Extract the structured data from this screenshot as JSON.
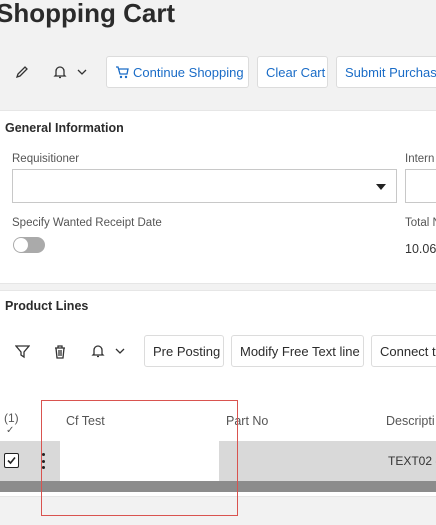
{
  "page": {
    "title": "Shopping Cart"
  },
  "toolbar": {
    "continue_label": "Continue Shopping",
    "clear_label": "Clear Cart",
    "submit_label": "Submit Purchase"
  },
  "general": {
    "title": "General Information",
    "requisitioner_label": "Requisitioner",
    "requisitioner_value": "",
    "internal_label": "Intern",
    "wanted_date_label": "Specify Wanted Receipt Date",
    "total_label": "Total N",
    "total_value": "10.06"
  },
  "lines": {
    "title": "Product Lines",
    "buttons": {
      "pre_posting": "Pre Posting",
      "modify_free_text": "Modify Free Text line",
      "connect": "Connect to"
    },
    "selected_count": "(1)",
    "check_glyph": "✓",
    "columns": {
      "cf_test": "Cf Test",
      "part_no": "Part No",
      "description": "Descripti"
    },
    "row": {
      "cf_test": "",
      "part_no": "",
      "description": "TEXT02 -"
    }
  },
  "icons": {
    "edit": "pencil-icon",
    "bell": "bell-icon",
    "cart": "cart-icon",
    "filter": "filter-icon",
    "trash": "trash-icon",
    "menu": "kebab-menu-icon"
  },
  "colors": {
    "accent": "#1a6cc7",
    "row_selected": "#d9d9d9",
    "highlight": "#d9534f"
  }
}
